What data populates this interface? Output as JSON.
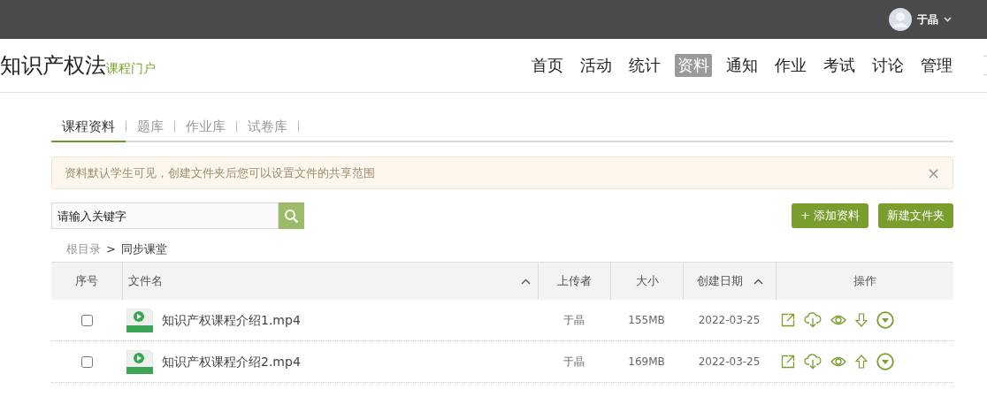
{
  "topbar": {
    "user": "于晶"
  },
  "header": {
    "title": "知识产权法",
    "subtitle": "课程门户"
  },
  "nav": [
    {
      "label": "首页",
      "selected": false
    },
    {
      "label": "活动",
      "selected": false
    },
    {
      "label": "统计",
      "selected": false
    },
    {
      "label": "资料",
      "selected": true
    },
    {
      "label": "通知",
      "selected": false
    },
    {
      "label": "作业",
      "selected": false
    },
    {
      "label": "考试",
      "selected": false
    },
    {
      "label": "讨论",
      "selected": false
    },
    {
      "label": "管理",
      "selected": false
    }
  ],
  "tabs": [
    {
      "label": "课程资料",
      "selected": true
    },
    {
      "label": "题库",
      "selected": false
    },
    {
      "label": "作业库",
      "selected": false
    },
    {
      "label": "试卷库",
      "selected": false
    }
  ],
  "notice": {
    "text": "资料默认学生可见，创建文件夹后您可以设置文件的共享范围",
    "close": "×"
  },
  "search": {
    "placeholder": "请输入关键字"
  },
  "buttons": [
    "+ 添加资料",
    "新建文件夹"
  ],
  "breadcrumb": [
    {
      "label": "根目录",
      "current": false
    },
    {
      "label": "同步课堂",
      "current": true
    }
  ],
  "breadcrumb_separator": ">",
  "table": {
    "columns": [
      {
        "label": "序号",
        "sortable": false
      },
      {
        "label": "文件名",
        "sortable": true
      },
      {
        "label": "上传者",
        "sortable": false
      },
      {
        "label": "大小",
        "sortable": false
      },
      {
        "label": "创建日期",
        "sortable": true
      },
      {
        "label": "操作",
        "sortable": false
      }
    ],
    "rows": [
      {
        "checked": false,
        "name": "知识产权课程介绍1.mp4",
        "uploader": "于晶",
        "size": "155MB",
        "date": "2022-03-25",
        "actions": [
          {
            "kind": "share"
          },
          {
            "kind": "download"
          },
          {
            "kind": "preview"
          },
          {
            "kind": "move_down"
          },
          {
            "kind": "more"
          }
        ]
      },
      {
        "checked": false,
        "name": "知识产权课程介绍2.mp4",
        "uploader": "于晶",
        "size": "169MB",
        "date": "2022-03-25",
        "actions": [
          {
            "kind": "share"
          },
          {
            "kind": "download"
          },
          {
            "kind": "preview"
          },
          {
            "kind": "move_up"
          },
          {
            "kind": "more"
          }
        ]
      }
    ]
  }
}
